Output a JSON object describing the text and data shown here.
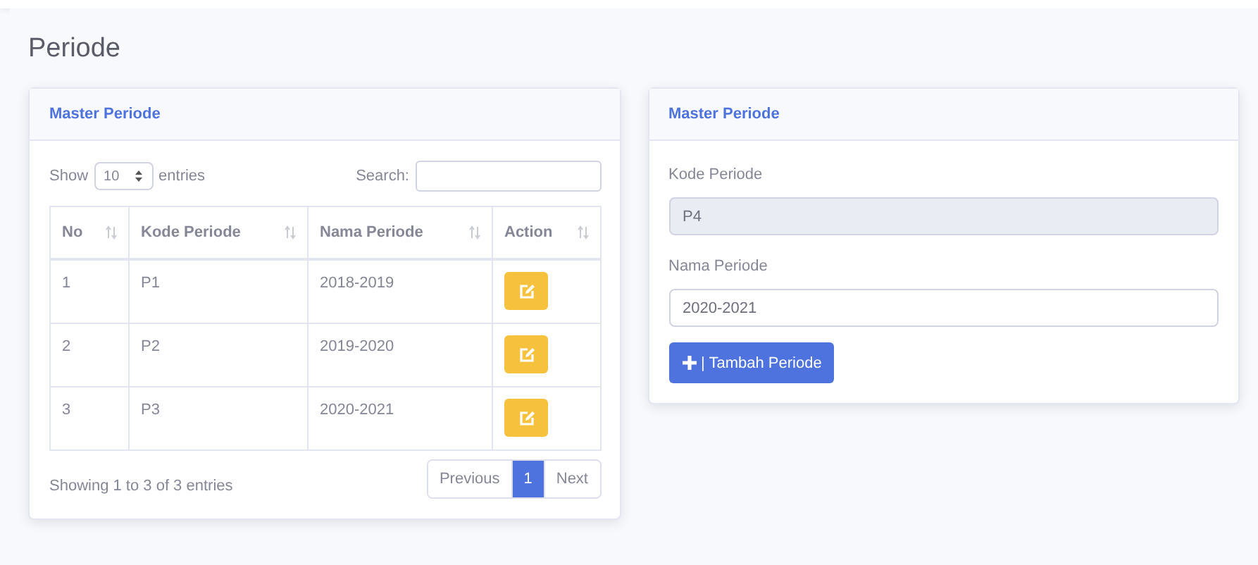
{
  "page_title": "Periode",
  "list_card": {
    "title": "Master Periode",
    "length": {
      "label_before": "Show",
      "value": "10",
      "label_after": "entries"
    },
    "search": {
      "label": "Search:"
    },
    "columns": [
      "No",
      "Kode Periode",
      "Nama Periode",
      "Action"
    ],
    "rows": [
      {
        "cells": [
          "1",
          "P1",
          "2018-2019"
        ]
      },
      {
        "cells": [
          "2",
          "P2",
          "2019-2020"
        ]
      },
      {
        "cells": [
          "3",
          "P3",
          "2020-2021"
        ]
      }
    ],
    "info": "Showing 1 to 3 of 3 entries",
    "pagination": [
      {
        "label": "Previous",
        "kind": "nav",
        "disabled": true
      },
      {
        "label": "1",
        "kind": "page",
        "selected": true
      },
      {
        "label": "Next",
        "kind": "nav",
        "disabled": true
      }
    ]
  },
  "form_card": {
    "title": "Master Periode",
    "fields": [
      {
        "label": "Kode Periode",
        "value": "P4",
        "readonly": true
      },
      {
        "label": "Nama Periode",
        "value": "2020-2021",
        "readonly": false
      }
    ],
    "submit": "| Tambah Periode"
  }
}
